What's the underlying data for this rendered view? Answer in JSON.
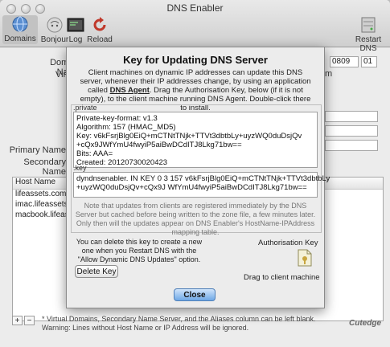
{
  "window": {
    "title": "DNS Enabler"
  },
  "toolbar": {
    "items": [
      {
        "label": "Domains",
        "icon": "globe-icon"
      },
      {
        "label": "Bonjour",
        "icon": "bonjour-icon"
      },
      {
        "label": "Log",
        "icon": "log-icon"
      },
      {
        "label": "Reload",
        "icon": "reload-icon"
      }
    ],
    "restart": {
      "label": "Restart DNS",
      "icon": "server-icon"
    }
  },
  "form": {
    "domain_name_label": "Domain Name",
    "virtual_label": "Virtual",
    "primary_name_label": "Primary Name",
    "secondary_name_label": "Secondary Name",
    "serial_value": "0809",
    "serial_suffix": "01",
    "right_fragment_1": "m"
  },
  "hosts": {
    "header": "Host Name",
    "rows": [
      "lifeassets.com",
      "imac.lifeassets.com",
      "macbook.lifeassets.com"
    ]
  },
  "footer": {
    "note_line1": "* Virtual Domains, Secondary Name Server, and the Aliases column can be left blank.",
    "note_line2": "Warning: Lines without Host Name or IP Address will be ignored.",
    "brand": "Cutedge"
  },
  "sheet": {
    "title": "Key for Updating DNS Server",
    "desc_part1": "Client machines on dynamic IP addresses can update this DNS server, whenever their IP addresses change, by using an application called ",
    "desc_link": "DNS Agent",
    "desc_part2": ". Drag the Authorisation Key, below (if it is not empty), to the client machine running DNS Agent. Double-click there to install.",
    "private_label": ".private",
    "private_lines": [
      "Private-key-format: v1.3",
      "Algorithm: 157 (HMAC_MD5)",
      "Key: v6kFsrjBlg0EiQ+mCTNtTNjk+TTVt3dbtbLy+uyzWQ0duDsjQv",
      "+cQx9JWfYmU4fwyiP5aiBwDCdITJ8Lkg71bw==",
      "Bits: AAA=",
      "Created: 20120730020423"
    ],
    "key_label": ".key",
    "key_lines": [
      "dyndnsenabler. IN KEY 0 3 157 v6kFsrjBlg0EiQ+mCTNtTNjk+TTVt3dbtbLy",
      "+uyzWQ0duDsjQv+cQx9J WfYmU4fwyiP5aiBwDCdITJ8Lkg71bw=="
    ],
    "note": "Note that updates from clients are registered immediately by the DNS Server but cached before being written to the zone file, a few minutes later. Only then will the updates appear on DNS Enabler's HostName-IPAddress mapping table.",
    "delete_text": "You can delete this key to create a new one when you Restart DNS with the \"Allow Dynamic DNS Updates\" option.",
    "delete_button": "Delete Key",
    "auth_label": "Authorisation Key",
    "drag_label": "Drag to client machine",
    "close_button": "Close"
  },
  "colors": {
    "accent": "#6ea8e6",
    "window_bg": "#ececec"
  }
}
